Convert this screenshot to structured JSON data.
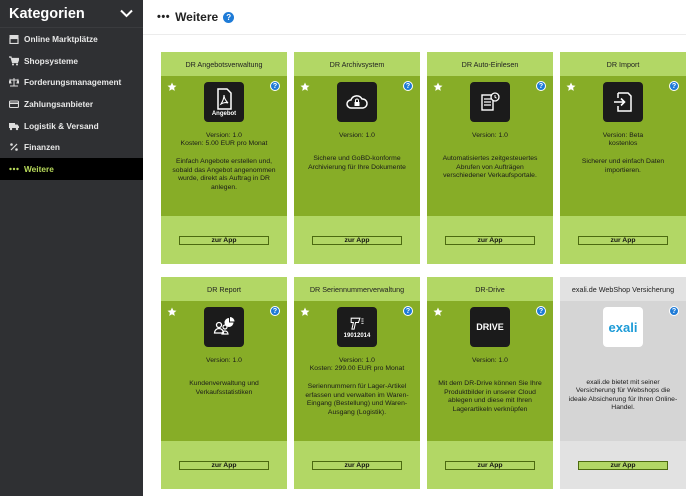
{
  "sidebar": {
    "title": "Kategorien",
    "items": [
      {
        "label": "Online Marktplätze",
        "icon": "storefront-icon"
      },
      {
        "label": "Shopsysteme",
        "icon": "cart-icon"
      },
      {
        "label": "Forderungsmanagement",
        "icon": "scale-icon"
      },
      {
        "label": "Zahlungsanbieter",
        "icon": "credit-card-icon"
      },
      {
        "label": "Logistik & Versand",
        "icon": "truck-icon"
      },
      {
        "label": "Finanzen",
        "icon": "percent-icon"
      },
      {
        "label": "Weitere",
        "icon": "dots-icon"
      }
    ]
  },
  "header": {
    "dots": "•••",
    "title": "Weitere",
    "help": "?"
  },
  "apps": [
    {
      "title": "DR Angebotsverwaltung",
      "logo_text": "Angebot",
      "version": "Version: 1.0",
      "cost": "Kosten: 5.00 EUR pro Monat",
      "desc": "Einfach Angebote erstellen und, sobald das Angebot angenommen wurde, direkt als Auftrag in DR anlegen.",
      "button": "zur App"
    },
    {
      "title": "DR Archivsystem",
      "logo_text": "",
      "version": "Version: 1.0",
      "cost": "",
      "desc": "Sichere und GoBD-konforme Archivierung für Ihre Dokumente",
      "button": "zur App"
    },
    {
      "title": "DR Auto-Einlesen",
      "logo_text": "",
      "version": "Version: 1.0",
      "cost": "",
      "desc": "Automatisiertes zeitgesteuertes Abrufen von Aufträgen verschiedener Verkaufsportale.",
      "button": "zur App"
    },
    {
      "title": "DR Import",
      "logo_text": "",
      "version": "Version: Beta",
      "cost": "kostenlos",
      "desc": "Sicherer und einfach Daten importieren.",
      "button": "zur App"
    },
    {
      "title": "DR Report",
      "logo_text": "",
      "version": "Version: 1.0",
      "cost": "",
      "desc": "Kundenverwaltung und Verkaufsstatistiken",
      "button": "zur App"
    },
    {
      "title": "DR Seriennummerverwaltung",
      "logo_text": "19012014",
      "version": "Version: 1.0",
      "cost": "Kosten: 299.00 EUR pro Monat",
      "desc": "Seriennummern für Lager-Artikel erfassen und verwalten im Waren-Eingang (Bestellung) und Waren-Ausgang (Logistik).",
      "button": "zur App"
    },
    {
      "title": "DR-Drive",
      "logo_text": "DRIVE",
      "version": "Version: 1.0",
      "cost": "",
      "desc": "Mit dem DR-Drive können Sie Ihre Produktbilder in unserer Cloud ablegen und diese mit Ihren Lagerartikeln verknüpfen",
      "button": "zur App"
    },
    {
      "title": "exali.de WebShop Versicherung",
      "logo_text": "exali",
      "version": "",
      "cost": "",
      "desc": "exali.de bietet mit seiner Versicherung für Webshops die ideale Absicherung für Ihren Online-Handel.",
      "button": "zur App"
    }
  ],
  "colors": {
    "accent": "#b7d95a",
    "tile_dark": "#87ad27",
    "tile_light": "#b2d765",
    "sidebar": "#2f3033",
    "help": "#1e7bd7"
  }
}
